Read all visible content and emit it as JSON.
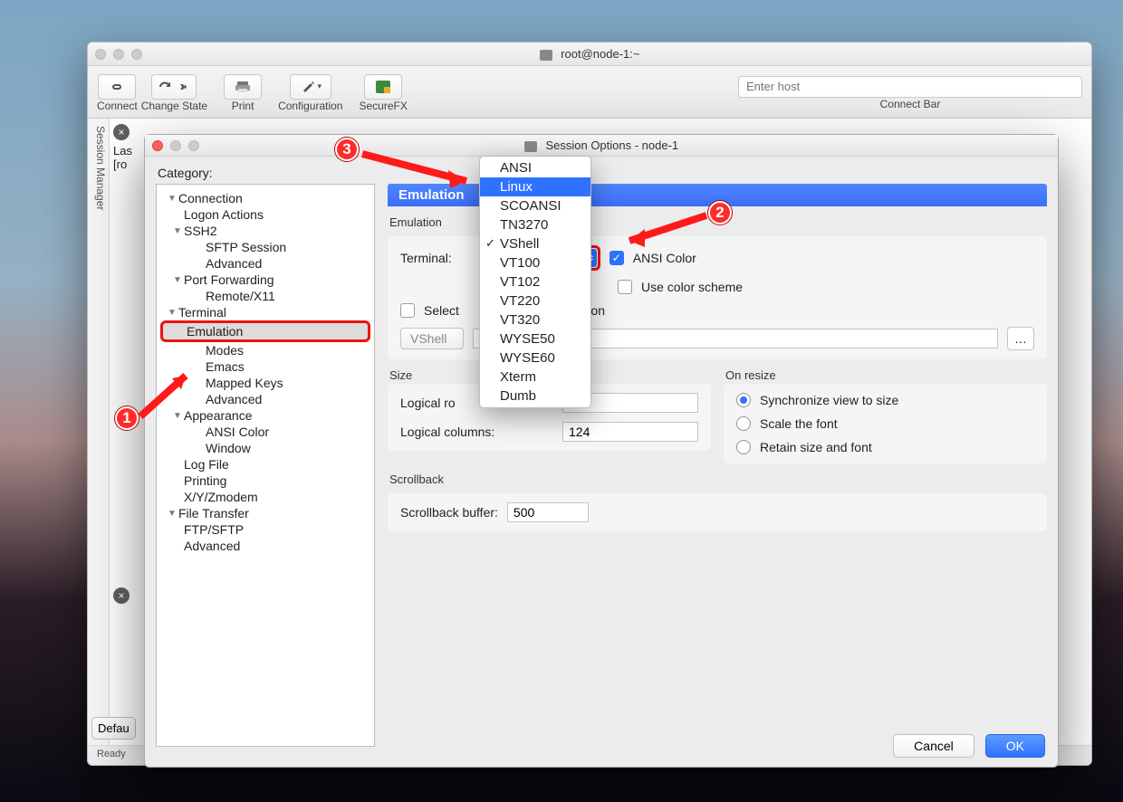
{
  "main_window": {
    "title": "root@node-1:~",
    "toolbar": {
      "connect": "Connect",
      "change_state": "Change State",
      "print": "Print",
      "configuration": "Configuration",
      "securefx": "SecureFX",
      "host_placeholder": "Enter host",
      "connect_bar": "Connect Bar"
    },
    "session_manager_tab": "Session Manager",
    "body_line1": "Las",
    "body_line2": "[ro",
    "defaults_button": "Defau",
    "status_text": "Ready"
  },
  "modal": {
    "title": "Session Options - node-1",
    "category_label": "Category:",
    "tree": {
      "connection": "Connection",
      "logon_actions": "Logon Actions",
      "ssh2": "SSH2",
      "sftp_session": "SFTP Session",
      "advanced1": "Advanced",
      "port_forwarding": "Port Forwarding",
      "remote_x11": "Remote/X11",
      "terminal": "Terminal",
      "emulation": "Emulation",
      "modes": "Modes",
      "emacs": "Emacs",
      "mapped_keys": "Mapped Keys",
      "advanced2": "Advanced",
      "appearance": "Appearance",
      "ansi_color": "ANSI Color",
      "window": "Window",
      "log_file": "Log File",
      "printing": "Printing",
      "xyzmodem": "X/Y/Zmodem",
      "file_transfer": "File Transfer",
      "ftp_sftp": "FTP/SFTP",
      "advanced3": "Advanced"
    },
    "right": {
      "banner": "Emulation",
      "emulation_title": "Emulation",
      "terminal_label": "Terminal:",
      "ansi_color": "ANSI Color",
      "use_color_scheme": "Use color scheme",
      "select_kbd": "Select keyboard emulation",
      "select_kbd_visible": "Select          keyboard emulation",
      "vshell_btn": "VShell",
      "size_title": "Size",
      "logical_rows_label": "Logical ro",
      "logical_cols_label": "Logical columns:",
      "logical_cols_value": "124",
      "on_resize_title": "On resize",
      "sync": "Synchronize view to size",
      "scale": "Scale the font",
      "retain": "Retain size and font",
      "scrollback_title": "Scrollback",
      "scrollback_label": "Scrollback buffer:",
      "scrollback_value": "500"
    },
    "footer": {
      "cancel": "Cancel",
      "ok": "OK"
    }
  },
  "dropdown": {
    "options": [
      "ANSI",
      "Linux",
      "SCOANSI",
      "TN3270",
      "VShell",
      "VT100",
      "VT102",
      "VT220",
      "VT320",
      "WYSE50",
      "WYSE60",
      "Xterm",
      "Dumb"
    ],
    "highlighted": "Linux",
    "checked": "VShell"
  },
  "annotations": {
    "n1": "1",
    "n2": "2",
    "n3": "3"
  }
}
